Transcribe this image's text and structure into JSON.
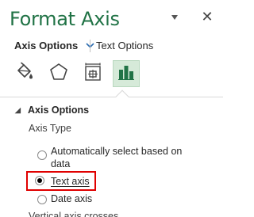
{
  "pane": {
    "title": "Format Axis",
    "dropdown_icon": "chevron-down-icon",
    "close_icon": "close-icon",
    "close_glyph": "✕"
  },
  "option_tabs": {
    "active": "Axis Options",
    "inactive": "Text Options"
  },
  "icon_tabs": [
    {
      "icon": "paint-bucket-icon",
      "selected": false
    },
    {
      "icon": "pentagon-icon",
      "selected": false
    },
    {
      "icon": "size-properties-icon",
      "selected": false
    },
    {
      "icon": "bar-chart-icon",
      "selected": true
    }
  ],
  "section": {
    "caret": "◢",
    "title": "Axis Options",
    "axis_type_label": "Axis Type",
    "options": [
      {
        "label_line1": "Automatically select based on",
        "label_line2": "data",
        "checked": false
      },
      {
        "label": "Text axis",
        "checked": true
      },
      {
        "label": "Date axis",
        "checked": false
      }
    ],
    "next_label": "Vertical axis crosses"
  },
  "colors": {
    "title_green": "#217346",
    "selected_tab_bg": "#d6ead9",
    "highlight_red": "#e00000"
  }
}
